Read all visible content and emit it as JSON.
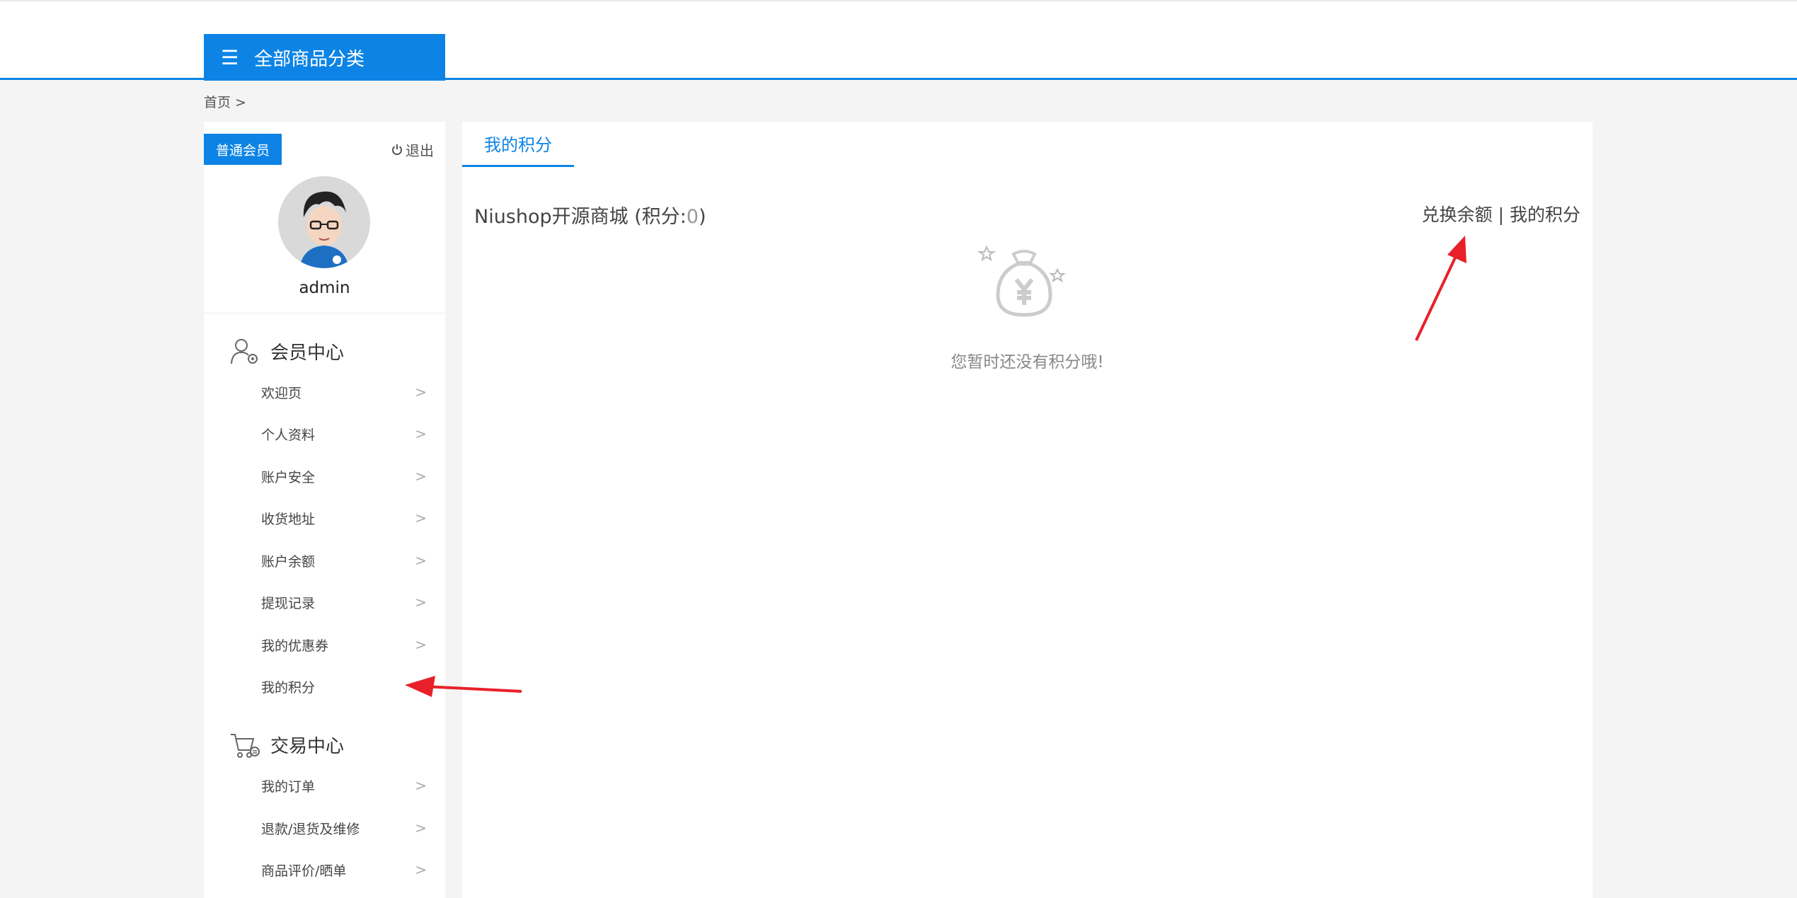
{
  "header": {
    "category_button": "全部商品分类",
    "menu_icon": "menu-icon"
  },
  "breadcrumb": "首页 >",
  "sidebar": {
    "member_level": "普通会员",
    "logout_label": "退出",
    "username": "admin",
    "sections": [
      {
        "title": "会员中心",
        "items": [
          "欢迎页",
          "个人资料",
          "账户安全",
          "收货地址",
          "账户余额",
          "提现记录",
          "我的优惠券",
          "我的积分"
        ]
      },
      {
        "title": "交易中心",
        "items": [
          "我的订单",
          "退款/退货及维修",
          "商品评价/晒单"
        ]
      }
    ]
  },
  "main": {
    "tab_label": "我的积分",
    "shop_name": "Niushop开源商城",
    "points_prefix": " (积分:",
    "points_value": "0",
    "points_suffix": ")",
    "link_exchange": "兑换余额",
    "link_separator": " | ",
    "link_mypoints": "我的积分",
    "empty_text": "您暂时还没有积分哦!"
  },
  "colors": {
    "accent": "#0d84e5",
    "annotation_arrow": "#e8202a"
  }
}
